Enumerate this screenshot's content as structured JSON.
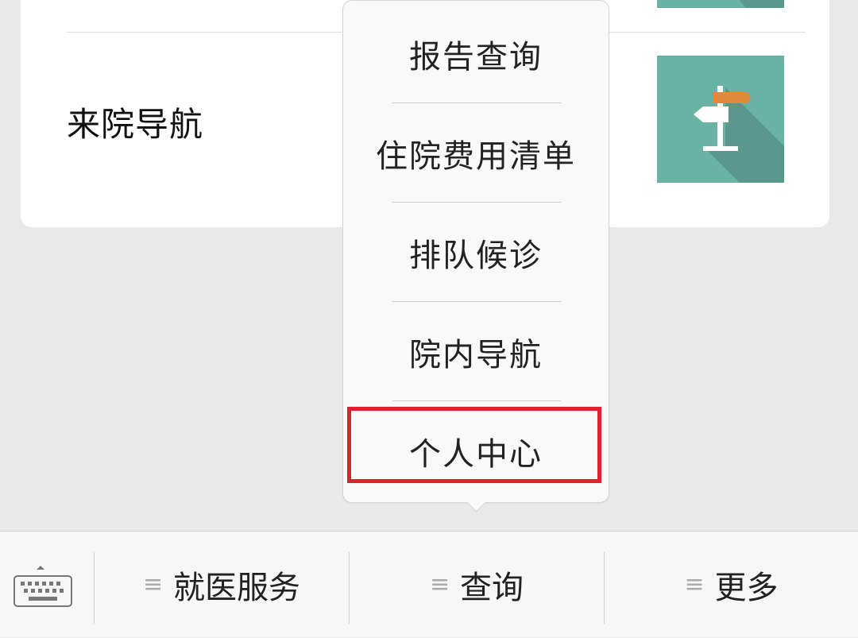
{
  "card": {
    "row_title": "来院导航",
    "thumb_icon": "signpost-icon",
    "colors": {
      "thumb_bg": "#6ab1a6",
      "thumb_shadow": "#5a988e",
      "sign_accent": "#e08a3c"
    }
  },
  "popup": {
    "items": [
      {
        "label": "报告查询"
      },
      {
        "label": "住院费用清单"
      },
      {
        "label": "排队候诊"
      },
      {
        "label": "院内导航"
      },
      {
        "label": "个人中心"
      }
    ],
    "highlight_color": "#e0202c"
  },
  "tabbar": {
    "keyboard_icon": "keyboard-icon",
    "menu_icon": "menu-lines-icon",
    "tabs": [
      {
        "label": "就医服务"
      },
      {
        "label": "查询"
      },
      {
        "label": "更多"
      }
    ]
  }
}
